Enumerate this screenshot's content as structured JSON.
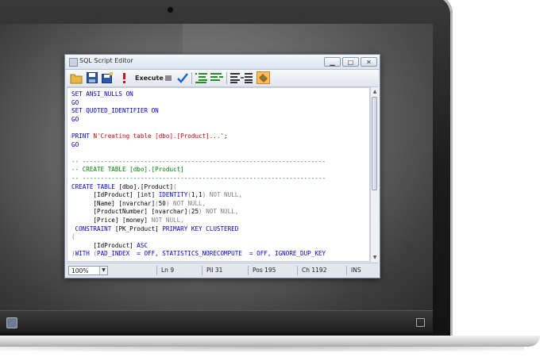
{
  "window": {
    "title": "SQL Script Editor",
    "controls": {
      "minimize": "▁",
      "maximize": "□",
      "close": "✕"
    }
  },
  "toolbar": {
    "execute_label": "Execute",
    "icons": [
      "open-folder-icon",
      "save-icon",
      "save-all-icon",
      "error-icon",
      "stop-icon",
      "check-icon",
      "indent-icon",
      "outdent-icon",
      "format-icon",
      "options-icon"
    ]
  },
  "editor": {
    "lines": [
      [
        {
          "t": "SET ANSI_NULLS ON",
          "c": "k"
        }
      ],
      [
        {
          "t": "GO",
          "c": "k"
        }
      ],
      [
        {
          "t": "SET QUOTED_IDENTIFIER ON",
          "c": "k"
        }
      ],
      [
        {
          "t": "GO",
          "c": "k"
        }
      ],
      [
        {
          "t": "",
          "c": ""
        }
      ],
      [
        {
          "t": "PRINT ",
          "c": "k"
        },
        {
          "t": "N'Creating table [dbo].[Product]...'",
          "c": "s"
        },
        {
          "t": ";",
          "c": ""
        }
      ],
      [
        {
          "t": "GO",
          "c": "k"
        }
      ],
      [
        {
          "t": "",
          "c": ""
        }
      ],
      [
        {
          "t": "-- -------------------------------------------------------------------",
          "c": "c"
        }
      ],
      [
        {
          "t": "-- CREATE TABLE [dbo].[Product]",
          "c": "c"
        }
      ],
      [
        {
          "t": "-- -------------------------------------------------------------------",
          "c": "c"
        }
      ],
      [
        {
          "t": "CREATE TABLE ",
          "c": "k"
        },
        {
          "t": "[dbo].[Product]",
          "c": ""
        },
        {
          "t": "(",
          "c": "g"
        }
      ],
      [
        {
          "t": "      [IdProduct] [int] ",
          "c": ""
        },
        {
          "t": "IDENTITY",
          "c": "k"
        },
        {
          "t": "(",
          "c": "g"
        },
        {
          "t": "1,1",
          "c": ""
        },
        {
          "t": ")",
          "c": "g"
        },
        {
          "t": " NOT NULL,",
          "c": "g"
        }
      ],
      [
        {
          "t": "      [Name] [nvarchar]",
          "c": ""
        },
        {
          "t": "(",
          "c": "g"
        },
        {
          "t": "50",
          "c": ""
        },
        {
          "t": ")",
          "c": "g"
        },
        {
          "t": " NOT NULL,",
          "c": "g"
        }
      ],
      [
        {
          "t": "      [ProductNumber] [nvarchar]",
          "c": ""
        },
        {
          "t": "(",
          "c": "g"
        },
        {
          "t": "25",
          "c": ""
        },
        {
          "t": ")",
          "c": "g"
        },
        {
          "t": " NOT NULL,",
          "c": "g"
        }
      ],
      [
        {
          "t": "      [Price] [money] ",
          "c": ""
        },
        {
          "t": "NOT NULL,",
          "c": "g"
        }
      ],
      [
        {
          "t": " CONSTRAINT ",
          "c": "k"
        },
        {
          "t": "[PK_Product] ",
          "c": ""
        },
        {
          "t": "PRIMARY KEY CLUSTERED",
          "c": "k"
        }
      ],
      [
        {
          "t": "(",
          "c": "g"
        }
      ],
      [
        {
          "t": "      [IdProduct] ",
          "c": ""
        },
        {
          "t": "ASC",
          "c": "k"
        }
      ],
      [
        {
          "t": ")",
          "c": "g"
        },
        {
          "t": "WITH ",
          "c": "k"
        },
        {
          "t": "(",
          "c": "g"
        },
        {
          "t": "PAD_INDEX  = OFF, STATISTICS_NORECOMPUTE  = OFF, IGNORE_DUP_KEY",
          "c": "k"
        }
      ]
    ]
  },
  "status": {
    "zoom": "100%",
    "line": "Ln 9",
    "column": "Pil 31",
    "position": "Pos 195",
    "char": "Ch 1192",
    "mode": "INS"
  }
}
